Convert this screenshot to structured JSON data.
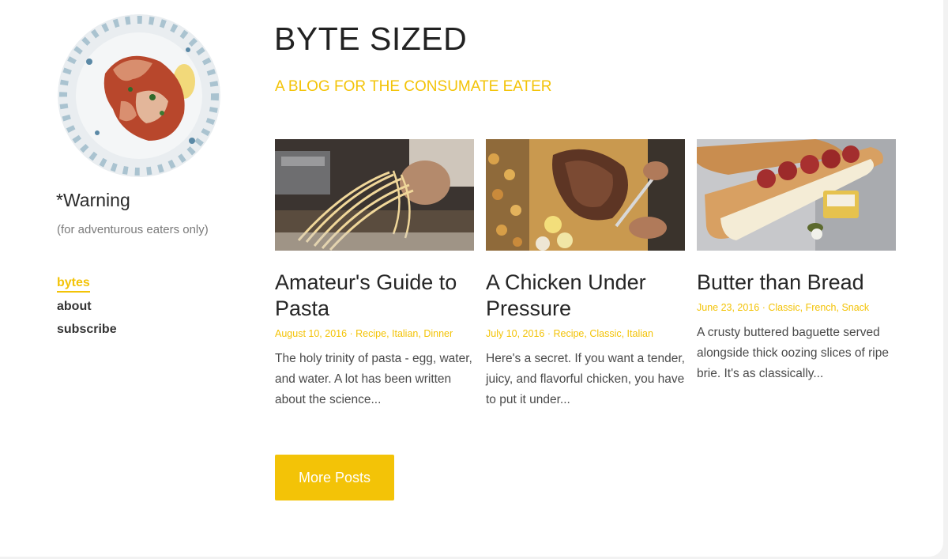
{
  "sidebar": {
    "warning_title": "*Warning",
    "warning_note": "(for adventurous eaters only)",
    "nav": [
      {
        "label": "bytes",
        "active": true
      },
      {
        "label": "about",
        "active": false
      },
      {
        "label": "subscribe",
        "active": false
      }
    ]
  },
  "header": {
    "title": "BYTE SIZED",
    "tagline": "A BLOG FOR THE CONSUMATE EATER"
  },
  "posts": [
    {
      "title": "Amateur's Guide to Pasta",
      "date": "August 10, 2016",
      "categories": "Recipe, Italian, Dinner",
      "excerpt": "The holy trinity of pasta - egg, water, and water. A lot has been written about the science..."
    },
    {
      "title": "A Chicken Under Pressure",
      "date": "July 10, 2016",
      "categories": "Recipe, Classic, Italian",
      "excerpt": "Here's a secret. If you want a tender, juicy, and flavorful chicken, you have to put it under..."
    },
    {
      "title": "Butter than Bread",
      "date": "June 23, 2016",
      "categories": "Classic, French, Snack",
      "excerpt": "A crusty buttered baguette served alongside thick oozing slices of ripe brie. It's as classically..."
    }
  ],
  "more_button": "More Posts",
  "colors": {
    "accent": "#f3c307",
    "text": "#262626",
    "muted": "#7a7a7a",
    "background": "#ffffff"
  }
}
